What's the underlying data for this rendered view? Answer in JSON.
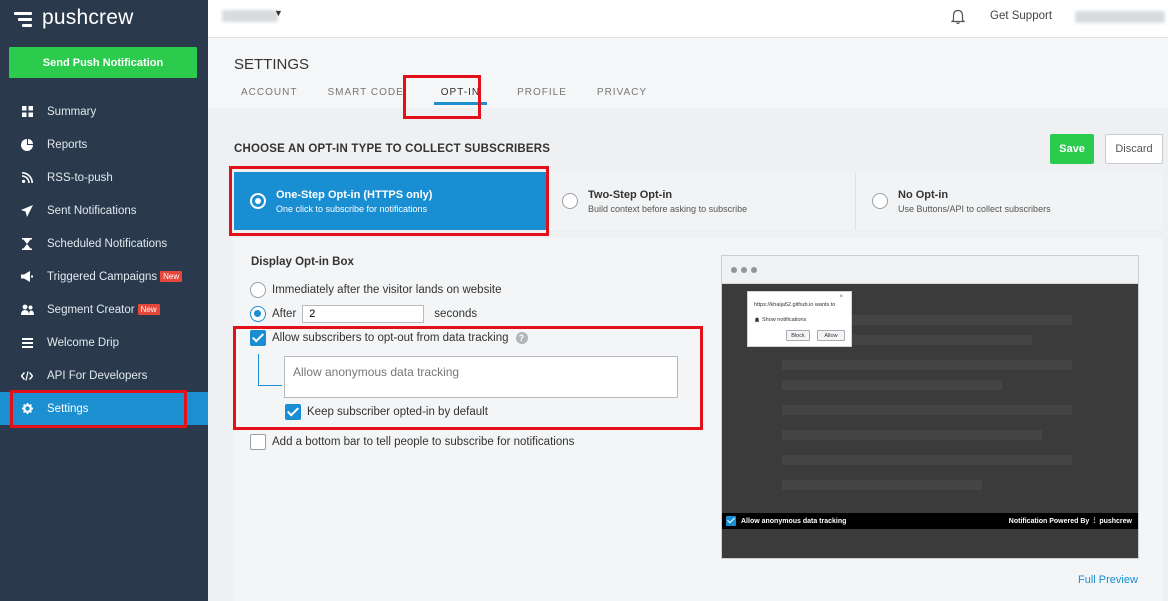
{
  "app": {
    "name": "pushcrew"
  },
  "sidebar": {
    "send_button": "Send Push Notification",
    "items": [
      {
        "label": "Summary",
        "icon": "grid-icon"
      },
      {
        "label": "Reports",
        "icon": "pie-chart-icon"
      },
      {
        "label": "RSS-to-push",
        "icon": "rss-icon"
      },
      {
        "label": "Sent Notifications",
        "icon": "paper-plane-icon"
      },
      {
        "label": "Scheduled Notifications",
        "icon": "hourglass-icon"
      },
      {
        "label": "Triggered Campaigns",
        "icon": "megaphone-icon",
        "badge": "New"
      },
      {
        "label": "Segment Creator",
        "icon": "users-icon",
        "badge": "New"
      },
      {
        "label": "Welcome Drip",
        "icon": "list-icon"
      },
      {
        "label": "API For Developers",
        "icon": "code-icon"
      },
      {
        "label": "Settings",
        "icon": "gear-icon",
        "active": true
      }
    ]
  },
  "topbar": {
    "support": "Get Support"
  },
  "settings": {
    "title": "SETTINGS",
    "tabs": [
      "ACCOUNT",
      "SMART CODE",
      "OPT-IN",
      "PROFILE",
      "PRIVACY"
    ],
    "active_tab": "OPT-IN"
  },
  "optin": {
    "title": "CHOOSE AN OPT-IN TYPE TO COLLECT SUBSCRIBERS",
    "save": "Save",
    "discard": "Discard",
    "types": [
      {
        "title": "One-Step Opt-in (HTTPS only)",
        "sub": "One click to subscribe for notifications",
        "selected": true
      },
      {
        "title": "Two-Step Opt-in",
        "sub": "Build context before asking to subscribe"
      },
      {
        "title": "No Opt-in",
        "sub": "Use Buttons/API to collect subscribers"
      }
    ]
  },
  "display": {
    "title": "Display Opt-in Box",
    "immediately": "Immediately after the visitor lands on website",
    "after_label": "After",
    "after_value": "2",
    "seconds": "seconds",
    "allow_optout": "Allow subscribers to opt-out from data tracking",
    "textarea_value": "Allow anonymous data tracking",
    "keep_optin": "Keep subscriber opted-in by default",
    "bottom_bar": "Add a bottom bar to tell people to subscribe for notifications"
  },
  "preview": {
    "url": "https://khaija52.github.io wants to",
    "show": "Show notifications",
    "block": "Block",
    "allow": "Allow",
    "footer_left": "Allow anonymous data tracking",
    "footer_right": "Notification Powered By",
    "brand": "pushcrew",
    "full_preview": "Full Preview"
  },
  "colors": {
    "sidebar": "#2a3a4c",
    "accent": "#1a8ed3",
    "green": "#2bcb4e",
    "highlight": "#e3101a"
  }
}
